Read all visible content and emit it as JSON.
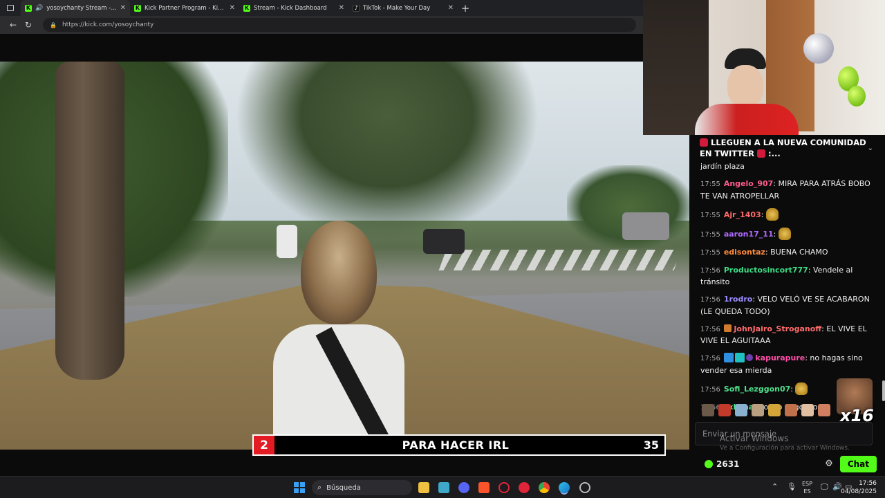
{
  "browser": {
    "tabs": [
      {
        "title": "yosoychanty Stream - Watch",
        "favicon": "kick",
        "audio": true,
        "active": true
      },
      {
        "title": "Kick Partner Program - Kick Dashb",
        "favicon": "kick",
        "audio": false,
        "active": false
      },
      {
        "title": "Stream - Kick Dashboard",
        "favicon": "kick",
        "audio": false,
        "active": false
      },
      {
        "title": "TikTok - Make Your Day",
        "favicon": "tiktok",
        "audio": false,
        "active": false
      }
    ],
    "url": "https://kick.com/yosoychanty"
  },
  "video": {
    "ticker": {
      "left_number": "2",
      "text": "PARA HACER IRL",
      "right_number": "35"
    }
  },
  "chat": {
    "pinned": "LLEGUEN A LA NUEVA COMUNIDAD EN TWITTER",
    "pinned_suffix": ":...",
    "first_line": "jardín plaza",
    "messages": [
      {
        "time": "17:55",
        "user": "Angelo_907",
        "color": "#ff5c8a",
        "text": "MIRA PARA ATRÁS BOBO TE VAN ATROPELLAR"
      },
      {
        "time": "17:55",
        "user": "Ajr_1403",
        "color": "#ff6a6a",
        "text": ""
      },
      {
        "time": "17:55",
        "user": "aaron17_11",
        "color": "#b06bff",
        "text": ""
      },
      {
        "time": "17:55",
        "user": "edisontaz",
        "color": "#ff8a3d",
        "text": "BUENA CHAMO"
      },
      {
        "time": "17:56",
        "user": "Productosincort777",
        "color": "#3ddc84",
        "text": "Vendele al tránsito"
      },
      {
        "time": "17:56",
        "user": "1rodro",
        "color": "#9b8cff",
        "text": "VELO VELÓ VE SE ACABARON (LE QUEDA TODO)"
      },
      {
        "time": "17:56",
        "user": "JohnJairo_Stroganoff",
        "color": "#ff6b6b",
        "text": "EL VIVE  EL VIVE  EL AGUITAAA"
      },
      {
        "time": "17:56",
        "user": "kapurapure",
        "color": "#ff4fa8",
        "text": "no hagas sino vender esa mierda"
      },
      {
        "time": "17:56",
        "user": "Sofi_Lezggon07",
        "color": "#4fe08a",
        "text": ""
      },
      {
        "time": "17:56",
        "user": "sxbxaa",
        "color": "#4fe08a",
        "text": "noooo pagoooo"
      }
    ],
    "combo_multiplier": "x16",
    "input_placeholder": "Enviar un mensaje",
    "points": "2631",
    "chat_button": "Chat",
    "watermark_title": "Activar Windows",
    "watermark_sub": "Ve a Configuración para activar Windows."
  },
  "taskbar": {
    "search_label": "Búsqueda",
    "lang_top": "ESP",
    "lang_bottom": "ES",
    "time": "17:56",
    "date": "04/08/2025"
  },
  "colors": {
    "kick_green": "#53fc18",
    "ticker_red": "#e31b23"
  }
}
